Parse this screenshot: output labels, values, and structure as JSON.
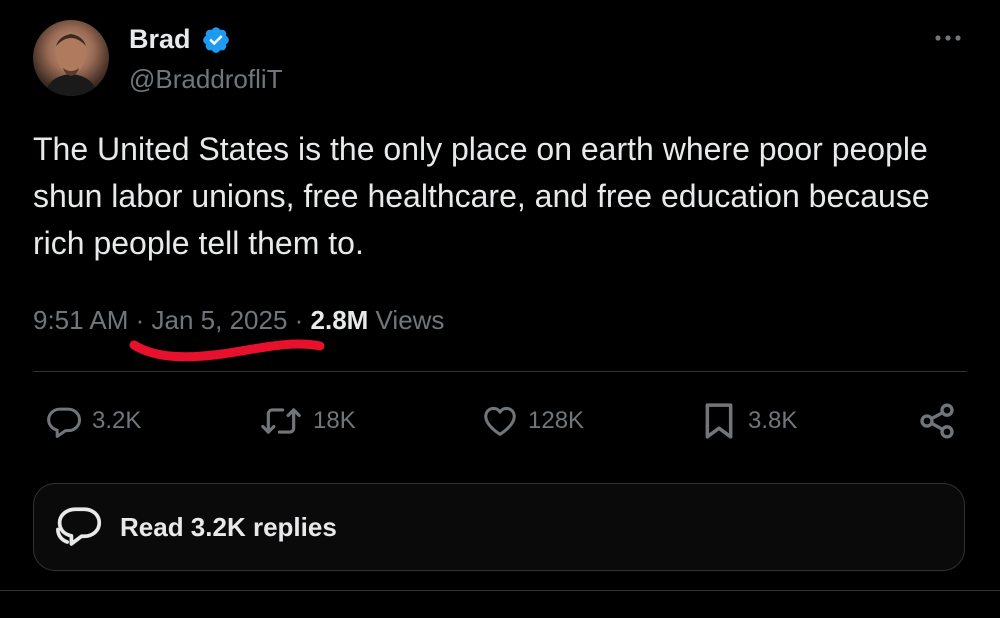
{
  "author": {
    "name": "Brad",
    "handle": "@BraddrofliT",
    "verified": true
  },
  "tweet": {
    "text": "The United States is the only place on earth where poor people shun labor unions, free healthcare, and free education because rich people tell them to.",
    "time": "9:51 AM",
    "separator": " · ",
    "date": "Jan 5, 2025",
    "views_count": "2.8M",
    "views_label": " Views"
  },
  "actions": {
    "replies": "3.2K",
    "reposts": "18K",
    "likes": "128K",
    "bookmarks": "3.8K"
  },
  "read_replies_label": "Read 3.2K replies",
  "colors": {
    "background": "#000000",
    "text": "#e7e9ea",
    "secondary": "#71767b",
    "verified": "#1d9bf0",
    "annotation": "#e8112d",
    "border": "#2f3336"
  },
  "icons": {
    "verified": "verified-badge-icon",
    "more": "more-dots-icon",
    "reply": "reply-bubble-icon",
    "repost": "repost-arrows-icon",
    "like": "heart-icon",
    "bookmark": "bookmark-icon",
    "share": "share-icon",
    "replies": "replies-bubble-icon"
  }
}
